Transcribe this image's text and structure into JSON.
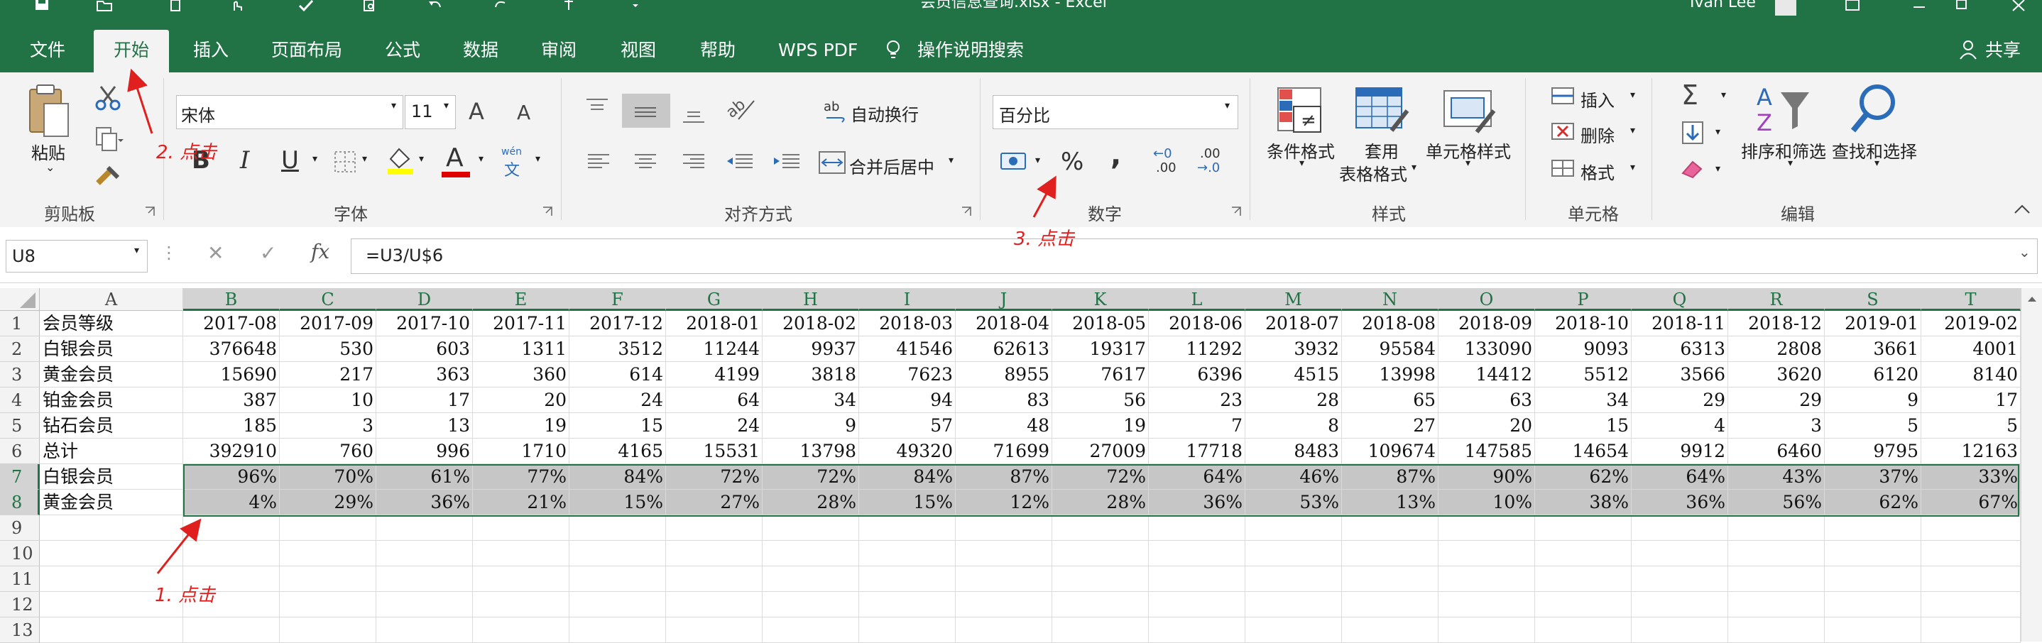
{
  "title_bar": {
    "doc_title": "会员信息查询.xlsx  -  Excel",
    "user": "Ivan Lee"
  },
  "tabs": [
    "文件",
    "开始",
    "插入",
    "页面布局",
    "公式",
    "数据",
    "审阅",
    "视图",
    "帮助",
    "WPS PDF"
  ],
  "active_tab": "开始",
  "tell_me": "操作说明搜索",
  "share": "共享",
  "ribbon": {
    "clipboard": {
      "label": "剪贴板",
      "paste": "粘贴"
    },
    "font": {
      "label": "字体",
      "font_name": "宋体",
      "font_size": "11",
      "bold": "B",
      "italic": "I",
      "underline": "U",
      "phonetic_top": "wén",
      "phonetic_bottom": "文",
      "grow": "A",
      "shrink": "A",
      "font_color": "A"
    },
    "alignment": {
      "label": "对齐方式",
      "wrap": "自动换行",
      "merge": "合并后居中"
    },
    "number": {
      "label": "数字",
      "format": "百分比",
      "percent": "%",
      "comma": ",",
      "inc_top": "←0",
      "inc_bottom": ".00",
      "dec_top": ".00",
      "dec_bottom": "→.0"
    },
    "styles": {
      "label": "样式",
      "conditional": "条件格式",
      "table_line1": "套用",
      "table_line2": "表格格式",
      "cell_styles": "单元格样式"
    },
    "cells": {
      "label": "单元格",
      "insert": "插入",
      "delete": "删除",
      "format": "格式"
    },
    "editing": {
      "label": "编辑",
      "sort": "排序和筛选",
      "find": "查找和选择",
      "sigma": "Σ"
    }
  },
  "formula_bar": {
    "name_box": "U8",
    "fx": "fx",
    "formula": "=U3/U$6"
  },
  "columns": [
    "A",
    "B",
    "C",
    "D",
    "E",
    "F",
    "G",
    "H",
    "I",
    "J",
    "K",
    "L",
    "M",
    "N",
    "O",
    "P",
    "Q",
    "R",
    "S",
    "T"
  ],
  "row_numbers": [
    "1",
    "2",
    "3",
    "4",
    "5",
    "6",
    "7",
    "8",
    "9",
    "10",
    "11",
    "12",
    "13"
  ],
  "rows": [
    [
      "会员等级",
      "2017-08",
      "2017-09",
      "2017-10",
      "2017-11",
      "2017-12",
      "2018-01",
      "2018-02",
      "2018-03",
      "2018-04",
      "2018-05",
      "2018-06",
      "2018-07",
      "2018-08",
      "2018-09",
      "2018-10",
      "2018-11",
      "2018-12",
      "2019-01",
      "2019-02"
    ],
    [
      "白银会员",
      "376648",
      "530",
      "603",
      "1311",
      "3512",
      "11244",
      "9937",
      "41546",
      "62613",
      "19317",
      "11292",
      "3932",
      "95584",
      "133090",
      "9093",
      "6313",
      "2808",
      "3661",
      "4001"
    ],
    [
      "黄金会员",
      "15690",
      "217",
      "363",
      "360",
      "614",
      "4199",
      "3818",
      "7623",
      "8955",
      "7617",
      "6396",
      "4515",
      "13998",
      "14412",
      "5512",
      "3566",
      "3620",
      "6120",
      "8140"
    ],
    [
      "铂金会员",
      "387",
      "10",
      "17",
      "20",
      "24",
      "64",
      "34",
      "94",
      "83",
      "56",
      "23",
      "28",
      "65",
      "63",
      "34",
      "29",
      "29",
      "9",
      "17"
    ],
    [
      "钻石会员",
      "185",
      "3",
      "13",
      "19",
      "15",
      "24",
      "9",
      "57",
      "48",
      "19",
      "7",
      "8",
      "27",
      "20",
      "15",
      "4",
      "3",
      "5",
      "5"
    ],
    [
      "总计",
      "392910",
      "760",
      "996",
      "1710",
      "4165",
      "15531",
      "13798",
      "49320",
      "71699",
      "27009",
      "17718",
      "8483",
      "109674",
      "147585",
      "14654",
      "9912",
      "6460",
      "9795",
      "12163"
    ],
    [
      "白银会员",
      "96%",
      "70%",
      "61%",
      "77%",
      "84%",
      "72%",
      "72%",
      "84%",
      "87%",
      "72%",
      "64%",
      "46%",
      "87%",
      "90%",
      "62%",
      "64%",
      "43%",
      "37%",
      "33%"
    ],
    [
      "黄金会员",
      "4%",
      "29%",
      "36%",
      "21%",
      "15%",
      "27%",
      "28%",
      "15%",
      "12%",
      "28%",
      "36%",
      "53%",
      "13%",
      "10%",
      "38%",
      "36%",
      "56%",
      "62%",
      "67%"
    ],
    [
      "",
      "",
      "",
      "",
      "",
      "",
      "",
      "",
      "",
      "",
      "",
      "",
      "",
      "",
      "",
      "",
      "",
      "",
      "",
      ""
    ],
    [
      "",
      "",
      "",
      "",
      "",
      "",
      "",
      "",
      "",
      "",
      "",
      "",
      "",
      "",
      "",
      "",
      "",
      "",
      "",
      ""
    ],
    [
      "",
      "",
      "",
      "",
      "",
      "",
      "",
      "",
      "",
      "",
      "",
      "",
      "",
      "",
      "",
      "",
      "",
      "",
      "",
      ""
    ],
    [
      "",
      "",
      "",
      "",
      "",
      "",
      "",
      "",
      "",
      "",
      "",
      "",
      "",
      "",
      "",
      "",
      "",
      "",
      "",
      ""
    ],
    [
      "",
      "",
      "",
      "",
      "",
      "",
      "",
      "",
      "",
      "",
      "",
      "",
      "",
      "",
      "",
      "",
      "",
      "",
      "",
      ""
    ]
  ],
  "annotations": [
    "1. 点击",
    "2. 点击",
    "3. 点击"
  ],
  "colors": {
    "excel_green": "#217346",
    "annotation_red": "#e0201e",
    "selection_fill": "#c6c6c6"
  }
}
